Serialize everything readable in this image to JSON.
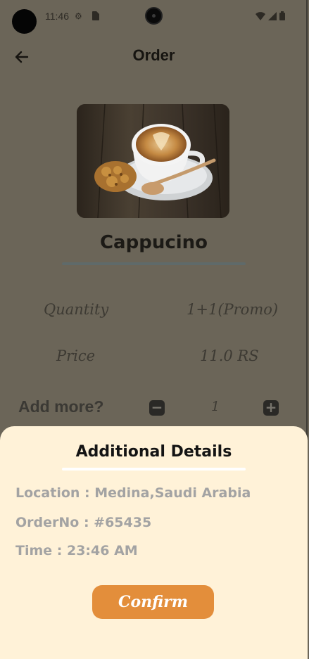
{
  "status_bar": {
    "time": "11:46"
  },
  "header": {
    "title": "Order"
  },
  "product": {
    "name": "Cappucino",
    "quantity_label": "Quantity",
    "quantity_value": "1+1(Promo)",
    "price_label": "Price",
    "price_value": "11.0 RS",
    "add_more_label": "Add more?",
    "add_more_count": "1"
  },
  "sheet": {
    "title": "Additional Details",
    "location": "Location : Medina,Saudi Arabia",
    "order_no": "OrderNo : #65435",
    "time": "Time : 23:46  AM",
    "confirm_label": "Confirm"
  },
  "colors": {
    "overlay_background": "#6b6558",
    "sheet_background": "#fff2d8",
    "confirm_button": "#e38e3b",
    "detail_text": "#a3a3a3"
  },
  "icons": {
    "back": "arrow-left-icon",
    "minus": "minus-square-icon",
    "plus": "plus-square-icon",
    "wifi": "wifi-icon",
    "signal": "signal-icon",
    "battery": "battery-icon",
    "settings": "gear-icon",
    "sim": "sim-card-icon"
  }
}
